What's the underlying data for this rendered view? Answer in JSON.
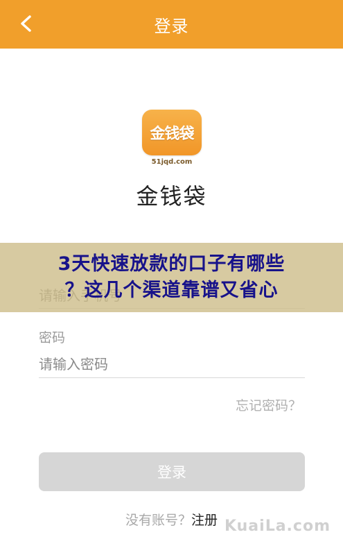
{
  "header": {
    "title": "登录",
    "back_icon": "chevron-left-icon"
  },
  "colors": {
    "brand": "#F19F2B",
    "button_disabled": "#D6D6D6",
    "banner_text": "#17128A"
  },
  "app": {
    "logo_text": "金钱袋",
    "logo_url_text": "51jqd.com",
    "name": "金钱袋"
  },
  "overlay_banner": {
    "line1": "3天快速放款的口子有哪些",
    "line2": "？这几个渠道靠谱又省心"
  },
  "form": {
    "phone_placeholder": "请输入手机号",
    "password_label": "密码",
    "password_placeholder": "请输入密码",
    "forgot_link": "忘记密码？",
    "login_button": "登录"
  },
  "register": {
    "prompt": "没有账号？",
    "link": "注册"
  },
  "watermark": "KuaiLa.com"
}
